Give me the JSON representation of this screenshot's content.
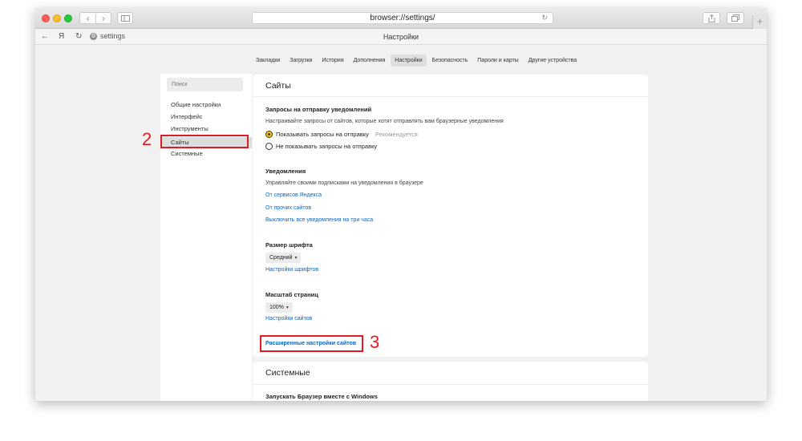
{
  "browser": {
    "url": "browser://settings/",
    "tab_url_label": "settings",
    "ya_button": "Я",
    "page_title": "Настройки",
    "new_tab": "+"
  },
  "settings_tabs": [
    {
      "label": "Закладки",
      "active": false
    },
    {
      "label": "Загрузки",
      "active": false
    },
    {
      "label": "История",
      "active": false
    },
    {
      "label": "Дополнения",
      "active": false
    },
    {
      "label": "Настройки",
      "active": true
    },
    {
      "label": "Безопасность",
      "active": false
    },
    {
      "label": "Пароли и карты",
      "active": false
    },
    {
      "label": "Другие устройства",
      "active": false
    }
  ],
  "sidebar": {
    "search_placeholder": "Поиск",
    "items": [
      {
        "label": "Общие настройки"
      },
      {
        "label": "Интерфейс"
      },
      {
        "label": "Инструменты"
      },
      {
        "label": "Сайты",
        "selected": true
      },
      {
        "label": "Системные"
      }
    ]
  },
  "sites": {
    "title": "Сайты",
    "notification_requests": {
      "title": "Запросы на отправку уведомлений",
      "description": "Настраивайте запросы от сайтов, которые хотят отправлять вам браузерные уведомления",
      "option_show": "Показывать запросы на отправку",
      "recommended": "Рекомендуется",
      "option_hide": "Не показывать запросы на отправку"
    },
    "notifications": {
      "title": "Уведомления",
      "description": "Управляйте своими подписками на уведомления в браузере",
      "link_yandex": "От сервисов Яндекса",
      "link_other": "От прочих сайтов",
      "link_disable": "Выключить все уведомления на три часа"
    },
    "font_size": {
      "title": "Размер шрифта",
      "value": "Средний",
      "link": "Настройки шрифтов"
    },
    "page_zoom": {
      "title": "Масштаб страниц",
      "value": "100%",
      "link": "Настройки сайтов"
    },
    "advanced_link": "Расширенные настройки сайтов"
  },
  "system": {
    "title": "Системные",
    "first_item": "Запускать Браузер вместе с Windows"
  },
  "annotations": {
    "step2": "2",
    "step3": "3",
    "color": "#e01b23"
  },
  "colors": {
    "link": "#0a66c2",
    "radio_checked": "#ffcc00"
  }
}
